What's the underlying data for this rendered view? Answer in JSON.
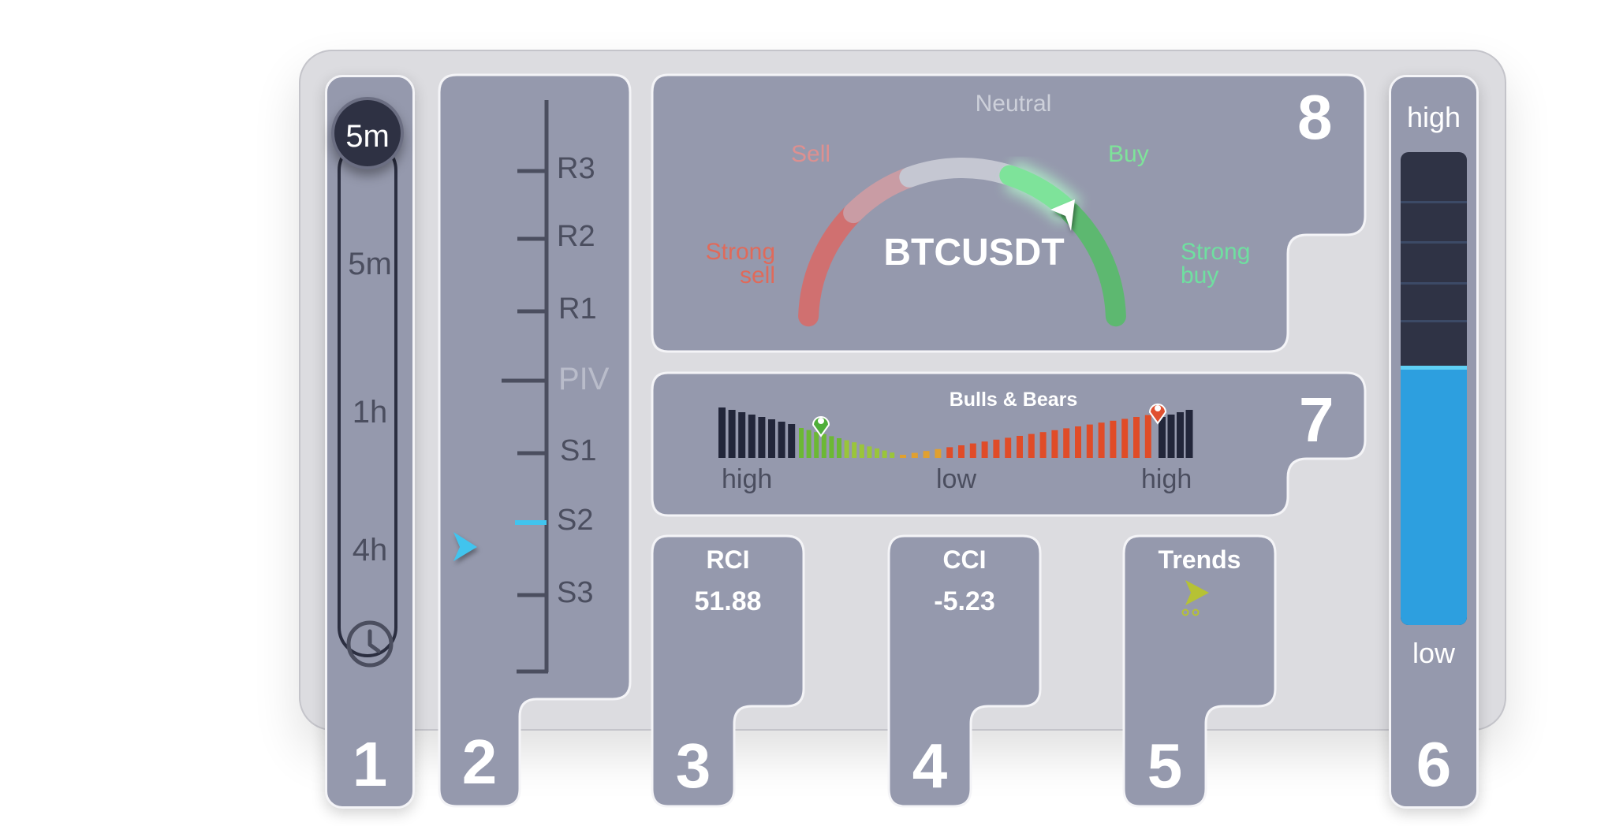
{
  "timeframe": {
    "selected": "5m",
    "options": [
      "5m",
      "1h",
      "4h"
    ],
    "panel_number": "1",
    "icon": "clock-icon"
  },
  "pivots": {
    "levels": [
      "R3",
      "R2",
      "R1",
      "PIV",
      "S1",
      "S2",
      "S3"
    ],
    "current_level": "S2",
    "panel_number": "2"
  },
  "rci": {
    "title": "RCI",
    "value": "51.88",
    "panel_number": "3"
  },
  "cci": {
    "title": "CCI",
    "value": "-5.23",
    "panel_number": "4"
  },
  "trends": {
    "title": "Trends",
    "icon": "trend-arrow-icon",
    "panel_number": "5"
  },
  "volume_bar": {
    "high_label": "high",
    "low_label": "low",
    "level_fraction": 0.54,
    "panel_number": "6"
  },
  "bulls_bears": {
    "title": "Bulls & Bears",
    "labels": [
      "high",
      "low",
      "high"
    ],
    "panel_number": "7"
  },
  "gauge": {
    "symbol": "BTCUSDT",
    "labels": {
      "strong_sell": "Strong sell",
      "sell": "Sell",
      "neutral": "Neutral",
      "buy": "Buy",
      "strong_buy": "Strong buy"
    },
    "current_reading": "Buy",
    "panel_number": "8"
  },
  "colors": {
    "panel": "#9599ad",
    "sell": "#e06a5a",
    "buy": "#7ee39a",
    "accent": "#41c4ee",
    "bar_fill": "#2d9fdf",
    "dark": "#2b2e40"
  }
}
